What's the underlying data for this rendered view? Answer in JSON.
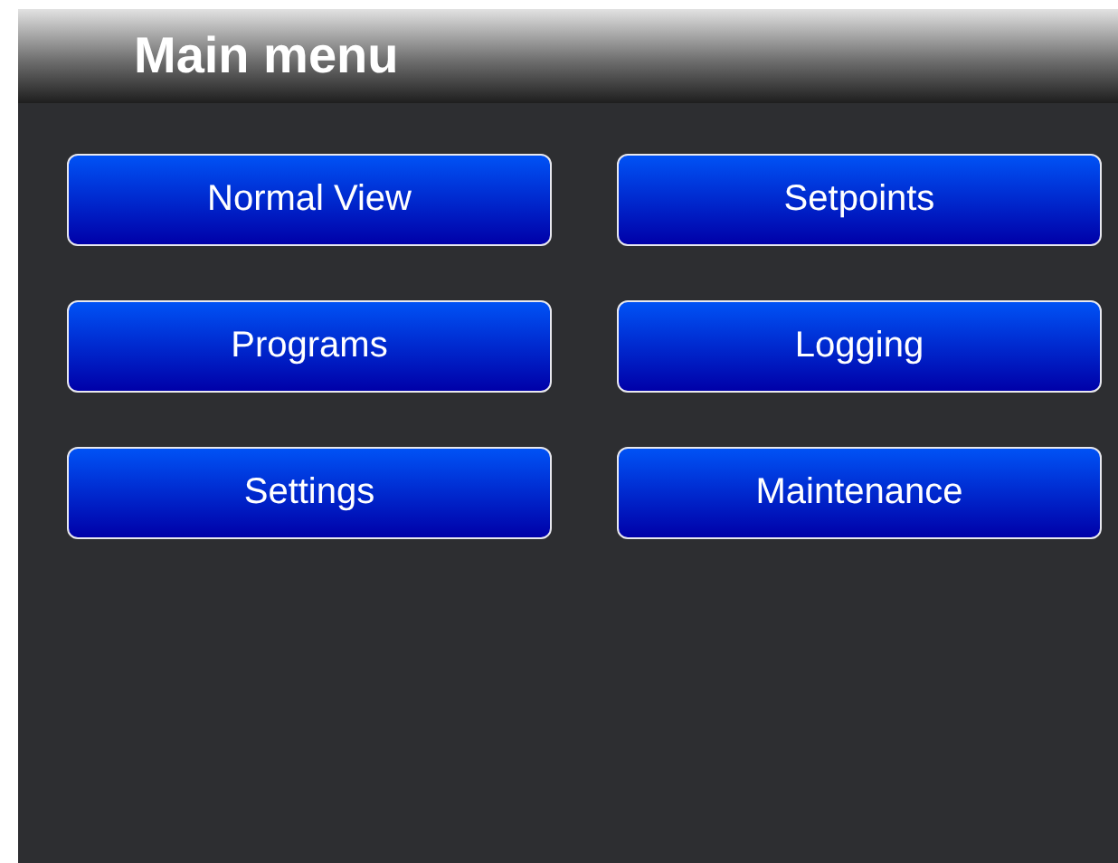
{
  "header": {
    "title": "Main menu"
  },
  "buttons": [
    {
      "label": "Normal View"
    },
    {
      "label": "Setpoints"
    },
    {
      "label": "Programs"
    },
    {
      "label": "Logging"
    },
    {
      "label": "Settings"
    },
    {
      "label": "Maintenance"
    }
  ]
}
